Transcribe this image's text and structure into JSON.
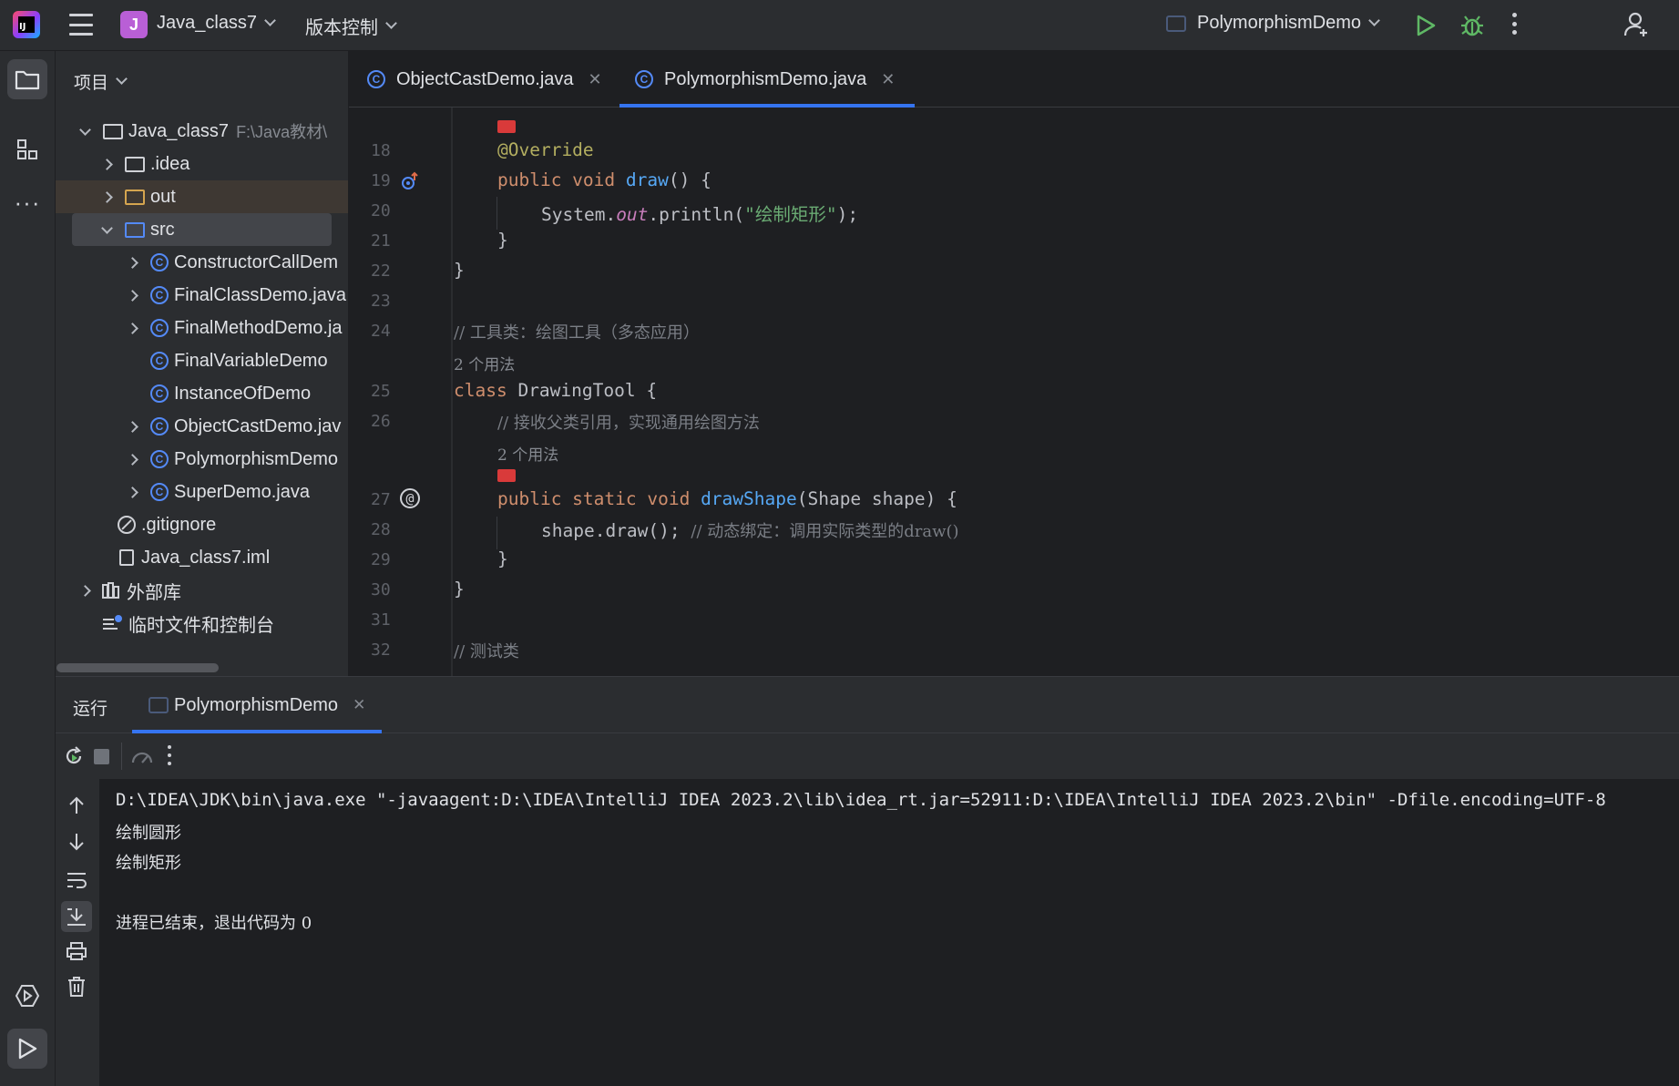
{
  "titlebar": {
    "project_badge": "J",
    "project_name": "Java_class7",
    "vcs_menu": "版本控制",
    "run_config": "PolymorphismDemo"
  },
  "project_pane": {
    "header": "项目",
    "root": {
      "name": "Java_class7",
      "path": "F:\\Java教材\\"
    },
    "items": [
      {
        "label": ".idea"
      },
      {
        "label": "out"
      },
      {
        "label": "src"
      },
      {
        "label": "ConstructorCallDem"
      },
      {
        "label": "FinalClassDemo.java"
      },
      {
        "label": "FinalMethodDemo.ja"
      },
      {
        "label": "FinalVariableDemo"
      },
      {
        "label": "InstanceOfDemo"
      },
      {
        "label": "ObjectCastDemo.jav"
      },
      {
        "label": "PolymorphismDemo"
      },
      {
        "label": "SuperDemo.java"
      },
      {
        "label": ".gitignore"
      },
      {
        "label": "Java_class7.iml"
      },
      {
        "label": "外部库"
      },
      {
        "label": "临时文件和控制台"
      }
    ]
  },
  "tabs": [
    {
      "label": "ObjectCastDemo.java",
      "icon": "C"
    },
    {
      "label": "PolymorphismDemo.java",
      "icon": "C",
      "active": true
    }
  ],
  "editor": {
    "line_numbers": [
      "18",
      "19",
      "20",
      "21",
      "22",
      "23",
      "24",
      "25",
      "26",
      "27",
      "28",
      "29",
      "30",
      "31",
      "32"
    ],
    "usages": [
      "2 个用法",
      "2 个用法"
    ],
    "code": {
      "l18_ann": "@Override",
      "l19_kw": "public void ",
      "l19_fn": "draw",
      "l19_rest": "() {",
      "l20_a": "System.",
      "l20_out": "out",
      "l20_b": ".println(",
      "l20_str": "\"绘制矩形\"",
      "l20_c": ");",
      "l21": "}",
      "l22": "}",
      "l24_cmt": "// 工具类：绘图工具（多态应用）",
      "l25_kw": "class ",
      "l25_rest": "DrawingTool {",
      "l26_cmt": "// 接收父类引用，实现通用绘图方法",
      "l27_kw": "public static void ",
      "l27_fn": "drawShape",
      "l27_rest": "(Shape shape) {",
      "l28_code": "shape.draw(); ",
      "l28_cmt": "// 动态绑定：调用实际类型的draw()",
      "l29": "}",
      "l30": "}",
      "l32_cmt": "// 测试类"
    }
  },
  "run_panel": {
    "title": "运行",
    "tab_label": "PolymorphismDemo",
    "console_lines": [
      "D:\\IDEA\\JDK\\bin\\java.exe \"-javaagent:D:\\IDEA\\IntelliJ IDEA 2023.2\\lib\\idea_rt.jar=52911:D:\\IDEA\\IntelliJ IDEA 2023.2\\bin\" -Dfile.encoding=UTF-8",
      "绘制圆形",
      "绘制矩形",
      "",
      "进程已结束，退出代码为 0"
    ]
  },
  "colors": {
    "accent": "#3574f0",
    "run_green": "#5fb865",
    "keyword": "#cf8e6d",
    "function": "#56a8f5",
    "string": "#6aab73"
  }
}
